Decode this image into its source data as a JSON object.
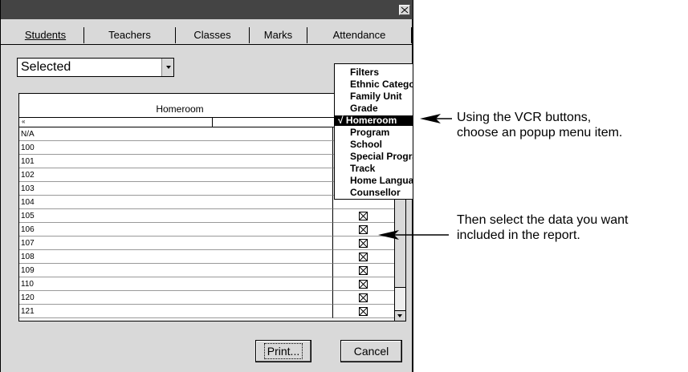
{
  "tabs": [
    "Students",
    "Teachers",
    "Classes",
    "Marks",
    "Attendance"
  ],
  "select": {
    "value": "Selected"
  },
  "grid": {
    "column_title": "Homeroom",
    "subheader_glyph": "«",
    "rows": [
      "N/A",
      "100",
      "101",
      "102",
      "103",
      "104",
      "105",
      "106",
      "107",
      "108",
      "109",
      "110",
      "120",
      "121"
    ]
  },
  "popup": {
    "items": [
      "Filters",
      "Ethnic Category",
      "Family Unit",
      "Grade",
      "√ Homeroom",
      "Program",
      "School",
      "Special Programs",
      "Track",
      "Home Language",
      "Counsellor"
    ],
    "selected_index": 4
  },
  "buttons": {
    "print": "Print...",
    "cancel": "Cancel"
  },
  "annotations": {
    "popup_line1": "Using the VCR buttons,",
    "popup_line2": "choose an popup menu item.",
    "data_line1": "Then select the data you want",
    "data_line2": "included in the report."
  }
}
